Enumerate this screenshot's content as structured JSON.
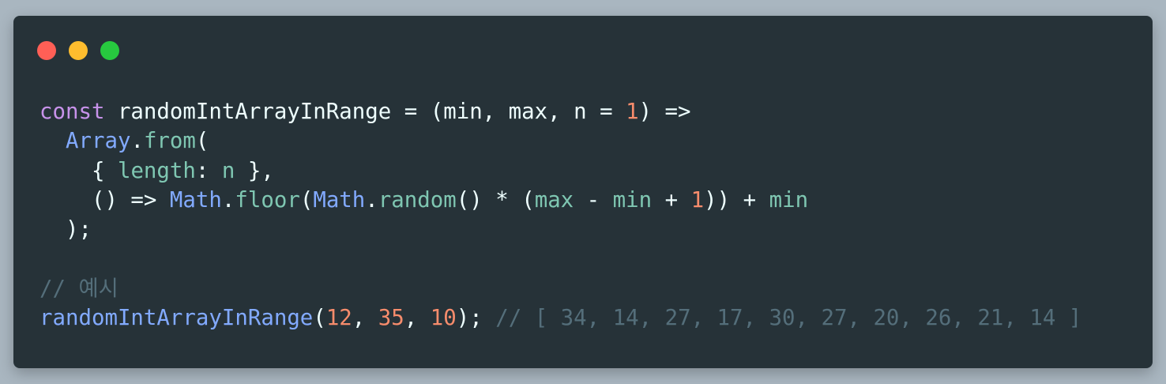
{
  "window": {
    "controls": [
      {
        "name": "close",
        "color": "#ff5f56"
      },
      {
        "name": "minimize",
        "color": "#ffbd2e"
      },
      {
        "name": "maximize",
        "color": "#27c93f"
      }
    ]
  },
  "colors": {
    "background": "#a9b6c0",
    "editor_bg": "#263238",
    "keyword": "#c792ea",
    "plain": "#eeffff",
    "number": "#f78c6c",
    "class": "#82aaff",
    "function": "#7fc7b2",
    "comment": "#546e7a"
  },
  "code": {
    "lines": [
      [
        {
          "t": "const",
          "c": "keyword"
        },
        {
          "t": " randomIntArrayInRange = (min, max, n = ",
          "c": "plain"
        },
        {
          "t": "1",
          "c": "num"
        },
        {
          "t": ") =>",
          "c": "plain"
        }
      ],
      [
        {
          "t": "  ",
          "c": "plain"
        },
        {
          "t": "Array",
          "c": "class"
        },
        {
          "t": ".",
          "c": "plain"
        },
        {
          "t": "from",
          "c": "func"
        },
        {
          "t": "(",
          "c": "plain"
        }
      ],
      [
        {
          "t": "    { ",
          "c": "plain"
        },
        {
          "t": "length",
          "c": "prop"
        },
        {
          "t": ": ",
          "c": "plain"
        },
        {
          "t": "n",
          "c": "prop"
        },
        {
          "t": " },",
          "c": "plain"
        }
      ],
      [
        {
          "t": "    () => ",
          "c": "plain"
        },
        {
          "t": "Math",
          "c": "class"
        },
        {
          "t": ".",
          "c": "plain"
        },
        {
          "t": "floor",
          "c": "func"
        },
        {
          "t": "(",
          "c": "plain"
        },
        {
          "t": "Math",
          "c": "class"
        },
        {
          "t": ".",
          "c": "plain"
        },
        {
          "t": "random",
          "c": "func"
        },
        {
          "t": "() * (",
          "c": "plain"
        },
        {
          "t": "max",
          "c": "prop"
        },
        {
          "t": " - ",
          "c": "plain"
        },
        {
          "t": "min",
          "c": "prop"
        },
        {
          "t": " + ",
          "c": "plain"
        },
        {
          "t": "1",
          "c": "num"
        },
        {
          "t": ")) + ",
          "c": "plain"
        },
        {
          "t": "min",
          "c": "prop"
        }
      ],
      [
        {
          "t": "  );",
          "c": "plain"
        }
      ],
      [],
      [
        {
          "t": "// 예시",
          "c": "comment"
        }
      ],
      [
        {
          "t": "randomIntArrayInRange",
          "c": "callname"
        },
        {
          "t": "(",
          "c": "plain"
        },
        {
          "t": "12",
          "c": "num"
        },
        {
          "t": ", ",
          "c": "plain"
        },
        {
          "t": "35",
          "c": "num"
        },
        {
          "t": ", ",
          "c": "plain"
        },
        {
          "t": "10",
          "c": "num"
        },
        {
          "t": "); ",
          "c": "plain"
        },
        {
          "t": "// [ 34, 14, 27, 17, 30, 27, 20, 26, 21, 14 ]",
          "c": "comment"
        }
      ]
    ]
  }
}
